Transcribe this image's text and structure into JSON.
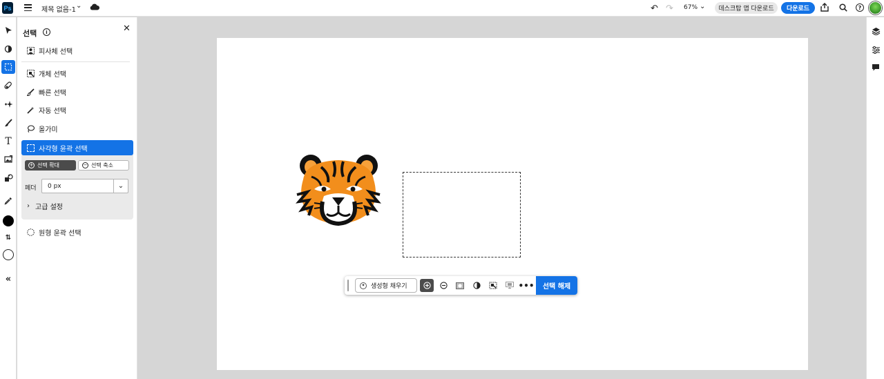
{
  "app": {
    "logo_text": "Ps",
    "document_title": "제목 없음-1",
    "zoom_level": "67%"
  },
  "header": {
    "desktop_download_label": "데스크탑 앱 다운로드",
    "download_label": "다운로드"
  },
  "panel": {
    "title": "선택",
    "items": {
      "subject": "피사체 선택",
      "object": "개체 선택",
      "quick": "빠른 선택",
      "magic": "자동 선택",
      "lasso": "올가미",
      "marquee": "사각형 윤곽 선택",
      "ellipse": "원형 윤곽 선택"
    },
    "add_label": "선택 확대",
    "subtract_label": "선택 축소",
    "feather_label": "페더",
    "feather_value": "0 px",
    "advanced_label": "고급 설정"
  },
  "taskbar": {
    "generative_fill_label": "생성형 채우기",
    "deselect_label": "선택 해제"
  },
  "colors": {
    "accent": "#1473e6",
    "foreground": "#000000",
    "background": "#ffffff"
  }
}
